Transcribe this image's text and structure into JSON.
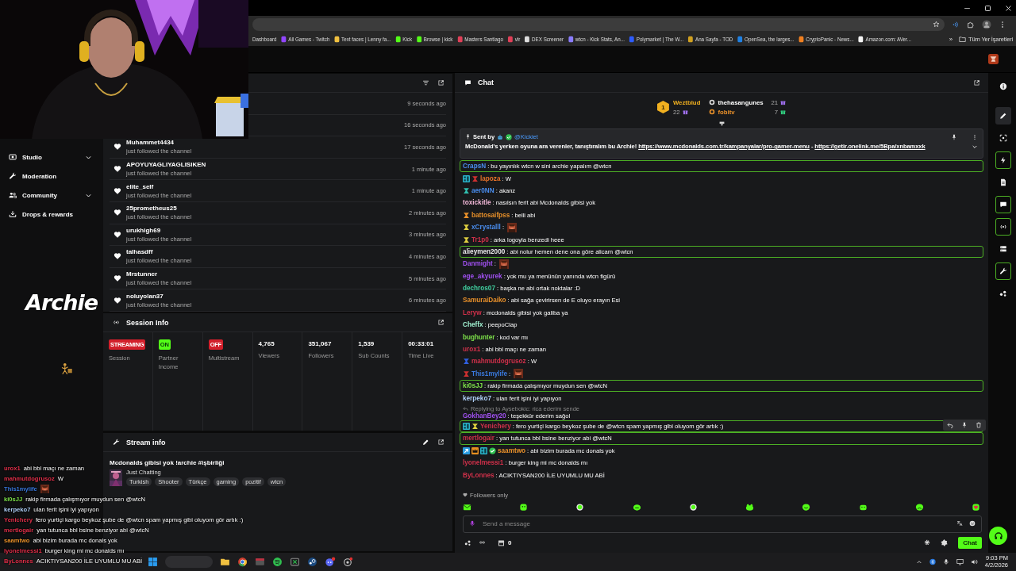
{
  "browser": {
    "bookmarks": [
      {
        "label": "Dashboard"
      },
      {
        "label": "All Games - Twitch",
        "color": "#9146ff"
      },
      {
        "label": "Text faces | Lenny fa...",
        "color": "#f0c040"
      },
      {
        "label": "Kick",
        "color": "#53fc18"
      },
      {
        "label": "Browse | kick",
        "color": "#53fc18"
      },
      {
        "label": "Masters Santiago",
        "color": "#e04058"
      },
      {
        "label": "vlr",
        "color": "#e04058"
      },
      {
        "label": "DEX Screener",
        "color": "#dddddd"
      },
      {
        "label": "wtcn - Kick Stats, An...",
        "color": "#8a7cff"
      },
      {
        "label": "Polymarket | The W...",
        "color": "#2e5cff"
      },
      {
        "label": "Ana Sayfa - TOD",
        "color": "#d0a020"
      },
      {
        "label": "OpenSea, the larges...",
        "color": "#2081e2"
      },
      {
        "label": "CryptoPanic - News...",
        "color": "#f08020"
      },
      {
        "label": "Amazon.com: AVer...",
        "color": "#f5f5f5"
      }
    ],
    "more": "»",
    "all_bookmarks": "Tüm Yer İşaretleri"
  },
  "sidebar": {
    "items": [
      {
        "label": "Studio",
        "kind": "studio",
        "has_submenu": true
      },
      {
        "label": "Moderation",
        "kind": "moderation",
        "has_submenu": false
      },
      {
        "label": "Community",
        "kind": "community",
        "has_submenu": true
      },
      {
        "label": "Drops & rewards",
        "kind": "drops",
        "has_submenu": false
      }
    ]
  },
  "followers": {
    "rows": [
      {
        "time": "9 seconds ago"
      },
      {
        "time": "16 seconds ago"
      },
      {
        "name": "Muhammet4434",
        "note": "just followed the channel",
        "time": "17 seconds ago"
      },
      {
        "name": "APOYUYAGLIYAGLISIKEN",
        "note": "just followed the channel",
        "time": "1 minute ago"
      },
      {
        "name": "elite_self",
        "note": "just followed the channel",
        "time": "1 minute ago"
      },
      {
        "name": "25prometheus25",
        "note": "just followed the channel",
        "time": "2 minutes ago"
      },
      {
        "name": "urukhigh69",
        "note": "just followed the channel",
        "time": "3 minutes ago"
      },
      {
        "name": "talhasdff",
        "note": "just followed the channel",
        "time": "4 minutes ago"
      },
      {
        "name": "Mrstunner",
        "note": "just followed the channel",
        "time": "5 minutes ago"
      },
      {
        "name": "noluyolan37",
        "note": "just followed the channel",
        "time": "6 minutes ago"
      }
    ]
  },
  "session_info": {
    "title": "Session Info",
    "stats": [
      {
        "kind": "badge",
        "badge": "STREAMING",
        "color": "#d21f2b",
        "label": "Session"
      },
      {
        "kind": "badge",
        "badge": "ON",
        "color": "#53fc18",
        "label": "Partner Income"
      },
      {
        "kind": "badge",
        "badge": "OFF",
        "color": "#d21f2b",
        "label": "Multistream"
      },
      {
        "kind": "stat",
        "value": "4,765",
        "label": "Viewers"
      },
      {
        "kind": "stat",
        "value": "351,067",
        "label": "Followers"
      },
      {
        "kind": "stat",
        "value": "1,539",
        "label": "Sub Counts"
      },
      {
        "kind": "stat",
        "value": "00:33:01",
        "label": "Time Live"
      }
    ]
  },
  "stream_info": {
    "title": "Stream info",
    "stream_title": "Mcdonalds gibisi yok !archie #işbirliği",
    "category": "Just Chatting",
    "tags": [
      "Turkish",
      "Shooter",
      "Türkçe",
      "gaming",
      "pozitif",
      "wtcn"
    ]
  },
  "chat": {
    "title": "Chat",
    "leaderboard": [
      {
        "rank": "1",
        "name": "Weztblud",
        "count": "22"
      },
      {
        "name": "thehasangunes",
        "count": "21"
      },
      {
        "name": "fobitv",
        "count": "7"
      }
    ],
    "pinned": {
      "sent_by": "Sent by",
      "author": "@Kickiet",
      "parts": [
        {
          "text": "McDonald's yerken oyuna ara verenler, tanıştıralım bu Archie! "
        },
        {
          "link": "https://www.mcdonalds.com.tr/kampanyalar/pro-gamer-menu"
        },
        {
          "text": " - "
        },
        {
          "link": "https://getir.onelink.me/5Bpa/xnbamxxk"
        }
      ]
    },
    "messages": [
      {
        "user": "CrapsN",
        "color": "#4a8ef0",
        "text": ": bu yayınlık wtcn w sini archie yapalım @wtcn",
        "highlighted": true,
        "hovered": false
      },
      {
        "user": "lapoza",
        "color": "#e8722a",
        "text": ": W",
        "badges": [
          {
            "kind": "grid"
          },
          {
            "kind": "sub",
            "color": "#d03030"
          }
        ],
        "highlighted": false,
        "hovered": false
      },
      {
        "user": "aer0NN",
        "color": "#4a8ef0",
        "text": ": akanz",
        "badges": [
          {
            "kind": "sub",
            "color": "#30c0b0"
          }
        ],
        "highlighted": false,
        "hovered": false
      },
      {
        "user": "toxickitle",
        "color": "#f2b8d8",
        "text": ": nasılsın ferit abi Mcdonalds gibisi yok",
        "highlighted": false,
        "hovered": false
      },
      {
        "user": "battosaifpss",
        "color": "#e8902a",
        "text": ": belli abi",
        "badges": [
          {
            "kind": "sub",
            "color": "#e8902a"
          }
        ],
        "highlighted": false,
        "hovered": false
      },
      {
        "user": "xCrystalll",
        "color": "#4a8ef0",
        "text": ":",
        "emote": true,
        "badges": [
          {
            "kind": "sub",
            "color": "#e0d040"
          }
        ],
        "highlighted": false,
        "hovered": false
      },
      {
        "user": "Tr1p0",
        "color": "#d0304a",
        "text": ": arka logoyla benzedi heee",
        "badges": [
          {
            "kind": "sub",
            "color": "#e0d040"
          }
        ],
        "highlighted": false,
        "hovered": false
      },
      {
        "user": "alieymen2000",
        "color": "#e8e8e8",
        "text": ": abi nolur hemen dene ona göre alicam @wtcn",
        "highlighted": true,
        "hovered": false
      },
      {
        "user": "Danmight",
        "color": "#a050f0",
        "text": ":",
        "emote": true,
        "highlighted": false,
        "hovered": false
      },
      {
        "user": "ege_akyurek",
        "color": "#a050f0",
        "text": ": yok mu ya menünün yanında wtcn figürü",
        "highlighted": false,
        "hovered": false
      },
      {
        "user": "dechros07",
        "color": "#40d0a0",
        "text": ": başka ne abi ortak noktalar :D",
        "highlighted": false,
        "hovered": false
      },
      {
        "user": "SamuraiDaiko",
        "color": "#e8902a",
        "text": ": abi sağa çevirirsen de E oluyo erayın Esi",
        "highlighted": false,
        "hovered": false
      },
      {
        "user": "Leryw",
        "color": "#d0304a",
        "text": ": mcdonalds gibisi yok galiba ya",
        "highlighted": false,
        "hovered": false
      },
      {
        "user": "Cheffx",
        "color": "#a0f0d0",
        "text": ": peepoClap",
        "highlighted": false,
        "hovered": false
      },
      {
        "user": "bughunter",
        "color": "#7de04a",
        "text": ": kod var mı",
        "highlighted": false,
        "hovered": false
      },
      {
        "user": "urox1",
        "color": "#d0304a",
        "text": ": abi bbl maçı ne zaman",
        "highlighted": false,
        "hovered": false
      },
      {
        "user": "mahmutdogrusoz",
        "color": "#d0304a",
        "text": ": W",
        "badges": [
          {
            "kind": "sub",
            "color": "#3060e0"
          }
        ],
        "highlighted": false,
        "hovered": false
      },
      {
        "user": "This1mylife",
        "color": "#3a7ae0",
        "text": ":",
        "emote": true,
        "badges": [
          {
            "kind": "sub",
            "color": "#d03030"
          }
        ],
        "highlighted": false,
        "hovered": false
      },
      {
        "user": "ki0sJJ",
        "color": "#7de04a",
        "text": ": rakip firmada çalışmıyor muydun sen @wtcN",
        "highlighted": true,
        "hovered": false
      },
      {
        "user": "kerpeko7",
        "color": "#b0d0f8",
        "text": ": ulan ferit işini iyi yapıyon",
        "highlighted": false,
        "hovered": false
      },
      {
        "user": "GokhanBey20",
        "color": "#a050f0",
        "text": ": teşekkür ederim sağol",
        "reply": "Replying to Aysebokic: rica ederim sende",
        "highlighted": false,
        "hovered": false
      },
      {
        "user": "Yenichery",
        "color": "#d0304a",
        "text": ": fero yurtiçi kargo beykoz şube de @wtcn spam yapmış gibi oluyom gör artık :)",
        "badges": [
          {
            "kind": "grid"
          },
          {
            "kind": "sub",
            "color": "#e0d040"
          }
        ],
        "highlighted": true,
        "hovered": true
      },
      {
        "user": "mertlogair",
        "color": "#d0304a",
        "text": ": yan tutunca bbl bsine benziyor abi @wtcN",
        "highlighted": true,
        "hovered": false
      },
      {
        "user": "saamtwo",
        "color": "#e8902a",
        "text": ": abi bizim burada mc donals yok",
        "badges": [
          {
            "kind": "arrow"
          },
          {
            "kind": "crown"
          },
          {
            "kind": "grid"
          },
          {
            "kind": "verified"
          }
        ],
        "highlighted": false,
        "hovered": false
      },
      {
        "user": "lyonelmessi1",
        "color": "#d0304a",
        "text": ": burger king mi mc donalds mı",
        "highlighted": false,
        "hovered": false
      },
      {
        "user": "ByLonnes",
        "color": "#d0304a",
        "text": ": ACIKTIYSAN200 İLE UYUMLU MU ABİ",
        "highlighted": false,
        "hovered": false
      }
    ],
    "mode": "Followers only",
    "quick_emotes": [
      {
        "kind": "mail"
      },
      {
        "kind": "blob"
      },
      {
        "kind": "ring"
      },
      {
        "kind": "grin"
      },
      {
        "kind": "ring"
      },
      {
        "kind": "frog"
      },
      {
        "kind": "smile"
      },
      {
        "kind": "sleepy"
      },
      {
        "kind": "frown"
      },
      {
        "kind": "heart"
      }
    ],
    "placeholder": "Send a message",
    "points": "0",
    "send": "Chat"
  },
  "rail": {
    "items": [
      {
        "kind": "info",
        "active": false,
        "selected": false
      },
      {
        "kind": "edit",
        "active": false,
        "selected": true
      },
      {
        "kind": "focus",
        "active": false,
        "selected": false
      },
      {
        "kind": "bolt",
        "active": true,
        "selected": false
      },
      {
        "kind": "doc",
        "active": false,
        "selected": false
      },
      {
        "kind": "chat",
        "active": true,
        "selected": false
      },
      {
        "kind": "broadcast",
        "active": true,
        "selected": false
      },
      {
        "kind": "stack",
        "active": false,
        "selected": false
      },
      {
        "kind": "tools",
        "active": true,
        "selected": false
      },
      {
        "kind": "nodes",
        "active": false,
        "selected": false
      }
    ]
  },
  "overlay": {
    "logo": "Archie",
    "chat": [
      {
        "user": "urox1",
        "color": "#e0304a",
        "text": "abi bbl maçı ne zaman"
      },
      {
        "user": "mahmutdogrusoz",
        "color": "#e0304a",
        "text": "W"
      },
      {
        "user": "This1mylife",
        "color": "#3a7ae0",
        "emote": true
      },
      {
        "user": "ki0sJJ",
        "color": "#7de04a",
        "text": "rakip firmada çalışmıyor muydun sen @wtcN"
      },
      {
        "user": "kerpeko7",
        "color": "#b0d0f8",
        "text": "ulan ferit işini iyi yapıyon"
      },
      {
        "user": "Yenichery",
        "color": "#e0304a",
        "text": "fero yurtiçi kargo beykoz şube de @wtcn spam yapmış gibi oluyom gör artık :)"
      },
      {
        "user": "mertlogair",
        "color": "#e0304a",
        "text": "yan tutunca bbl bsine benziyor abi @wtcN"
      },
      {
        "user": "saamtwo",
        "color": "#e8902a",
        "text": "abi bizim burada mc donals yok"
      },
      {
        "user": "lyonelmessi1",
        "color": "#e0304a",
        "text": "burger king mi mc donalds mı"
      },
      {
        "user": "ByLonnes",
        "color": "#e0304a",
        "text": "ACIKTIYSAN200 İLE UYUMLU MU ABİ"
      }
    ]
  },
  "taskbar": {
    "time": "9:03 PM",
    "date": "4/2/2026"
  }
}
